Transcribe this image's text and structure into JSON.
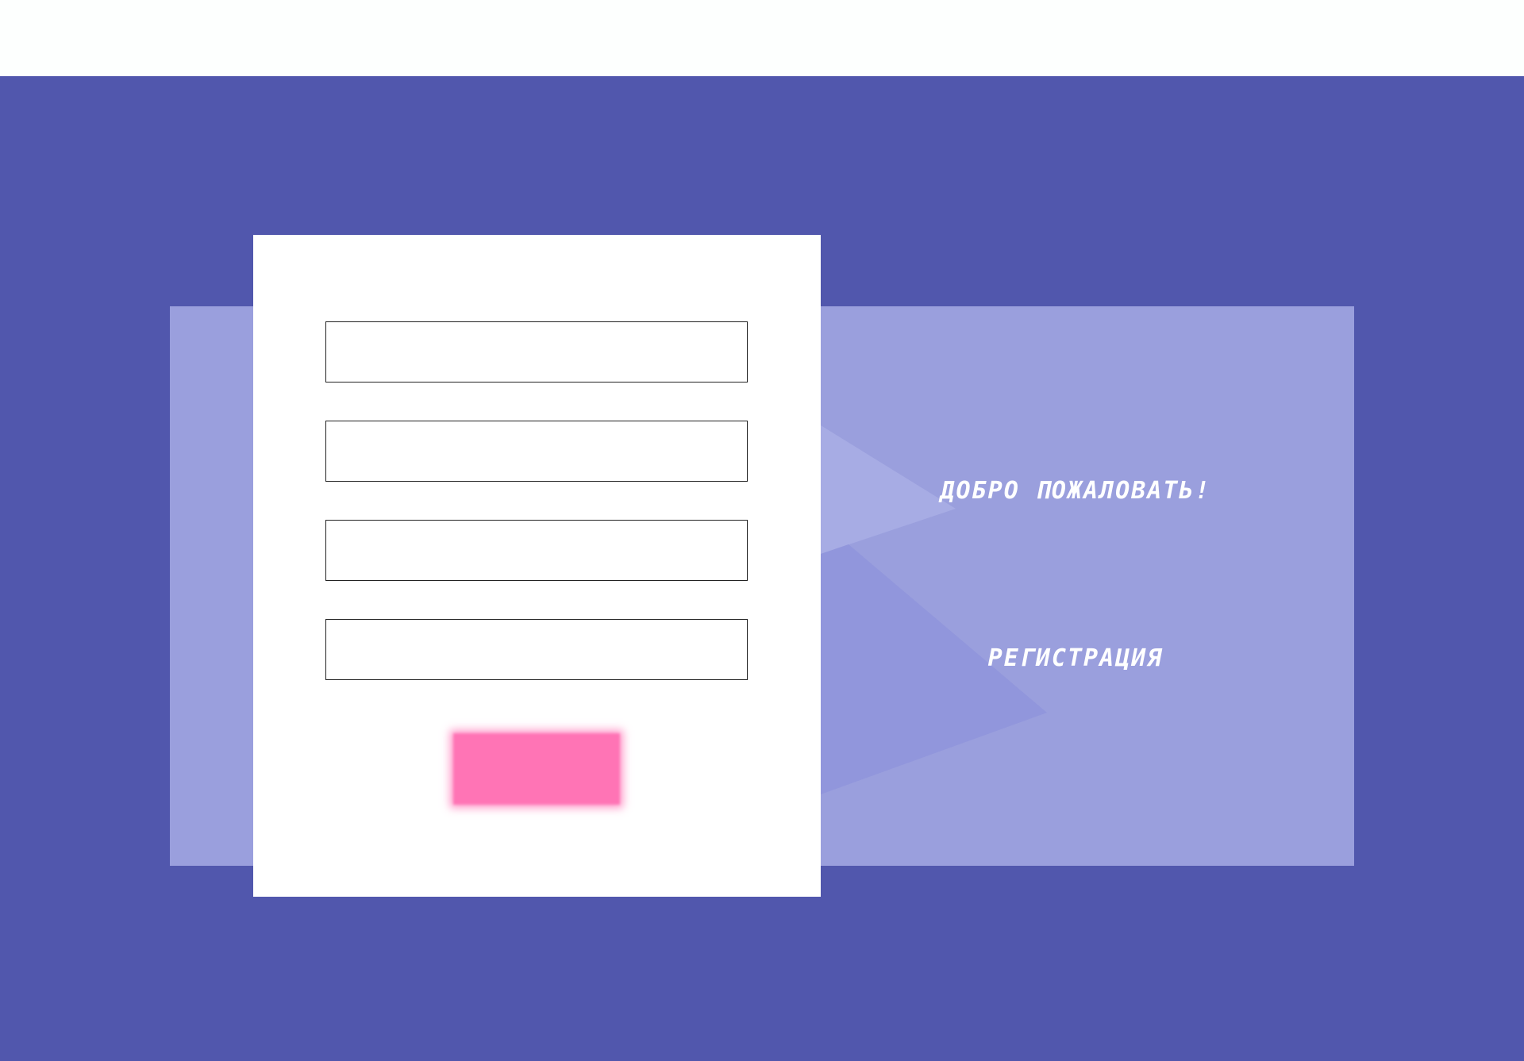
{
  "header": {},
  "form": {
    "fields": [
      {
        "name": "field-1",
        "value": "",
        "placeholder": ""
      },
      {
        "name": "field-2",
        "value": "",
        "placeholder": ""
      },
      {
        "name": "field-3",
        "value": "",
        "placeholder": ""
      },
      {
        "name": "field-4",
        "value": "",
        "placeholder": ""
      }
    ],
    "submit_label": ""
  },
  "welcome": {
    "title": "ДОБРО ПОЖАЛОВАТЬ!",
    "register_label": "РЕГИСТРАЦИЯ"
  },
  "colors": {
    "background": "#5157ad",
    "panel": "#9a9fdd",
    "card": "#ffffff",
    "accent": "#ff74b5",
    "top_bar": "#fdfffe"
  }
}
